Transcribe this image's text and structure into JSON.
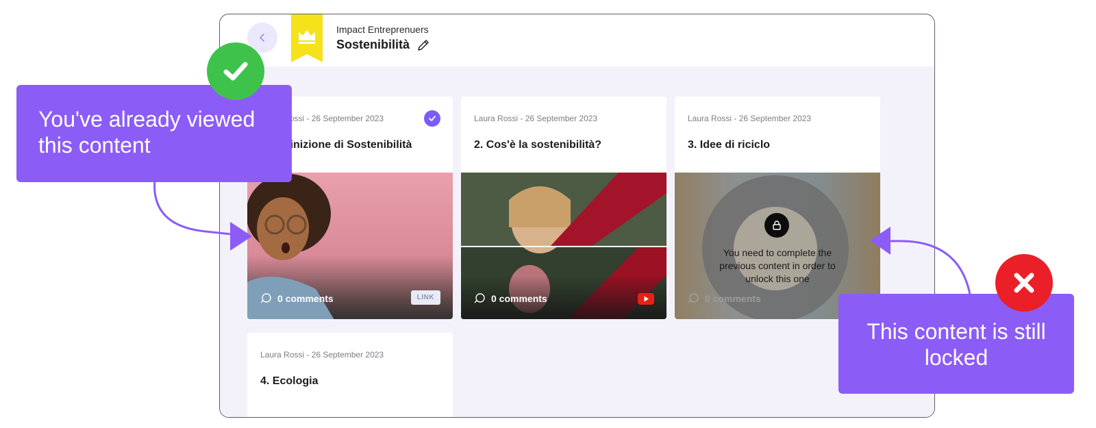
{
  "header": {
    "community_name": "Impact Entreprenuers",
    "space_title": "Sostenibilità"
  },
  "cards": [
    {
      "meta": "Laura Rossi - 26 September 2023",
      "title": "1. Definizione di Sostenibilità",
      "comments": "0 comments",
      "type_badge": "LINK",
      "status": "viewed"
    },
    {
      "meta": "Laura Rossi - 26 September 2023",
      "title": "2. Cos'è la sostenibilità?",
      "comments": "0 comments",
      "type_badge": "youtube-icon",
      "status": "available"
    },
    {
      "meta": "Laura Rossi - 26 September 2023",
      "title": "3. Idee di riciclo",
      "comments": "0 comments",
      "status": "locked",
      "lock_message": "You need to complete the previous content in order to unlock this one"
    },
    {
      "meta": "Laura Rossi - 26 September 2023",
      "title": "4. Ecologia"
    }
  ],
  "callouts": {
    "viewed": "You've already viewed this content",
    "locked": "This content is still locked"
  },
  "colors": {
    "accent": "#8c5cf6",
    "success": "#3ec24b",
    "error": "#ea1f27",
    "content_bg": "#f3f2fb",
    "ribbon": "#f5e21a"
  }
}
